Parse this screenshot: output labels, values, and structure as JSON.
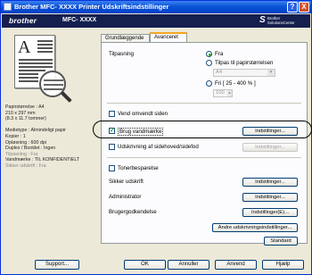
{
  "window": {
    "title": "Brother MFC- XXXX    Printer Udskriftsindstillinger",
    "help_glyph": "?",
    "close_glyph": "X"
  },
  "brand": {
    "logo": "brother",
    "model": "MFC- XXXX",
    "solutions_logo": "Brother\nSolutionsCenter"
  },
  "preview": {
    "letter": "A",
    "info": [
      {
        "text": "Papirstørrelse : A4",
        "dim": false
      },
      {
        "text": "210 x 297 mm",
        "dim": false
      },
      {
        "text": "(8.3 x 11.7 tommer)",
        "dim": false
      },
      {
        "text": "",
        "dim": false
      },
      {
        "text": "Medietype : Almindeligt papir",
        "dim": false
      },
      {
        "text": "Kopier : 1",
        "dim": false
      },
      {
        "text": "Opløsning : 600 dpi",
        "dim": false
      },
      {
        "text": "Duplex / Booklet : Ingen",
        "dim": false
      },
      {
        "text": "Tilpasning : Fra",
        "dim": true
      },
      {
        "text": "Vandmærke : TIL KONFIDENTIELT",
        "dim": false
      },
      {
        "text": "Sikker udskrift : Fra",
        "dim": true
      }
    ]
  },
  "tabs": {
    "basic": "Grundlæggende",
    "advanced": "Avanceret"
  },
  "advanced": {
    "scaling_label": "Tilpasning",
    "scaling_off": "Fra",
    "scaling_fit": "Tilpas til papirstørrelsen",
    "paper_select": "A4",
    "scaling_free": "Fri [ 25 - 400 % ]",
    "percent_value": "100",
    "reverse_print": "Vend omvendt siden",
    "use_watermark": "Brug vandmærke",
    "settings_button": "Indstillinger...",
    "header_footer": "Udskrivning af sidehoved/sidefod",
    "toner_save": "Tonerbesparelse",
    "secure_print": "Sikker udskrift",
    "administrator": "Administrator",
    "user_auth": "Brugergodkendelse",
    "user_auth_button": "Indstillinger(E)...",
    "other_print_options": "Andre udskrivningsindstillinger...",
    "default_button": "Standard"
  },
  "footer": {
    "support": "Support...",
    "ok": "OK",
    "cancel": "Annuller",
    "apply": "Anvend",
    "help": "Hjælp"
  },
  "colors": {
    "titlebar": "#0a53d6",
    "brand_band": "#15204f",
    "accent_check": "#21a121"
  }
}
